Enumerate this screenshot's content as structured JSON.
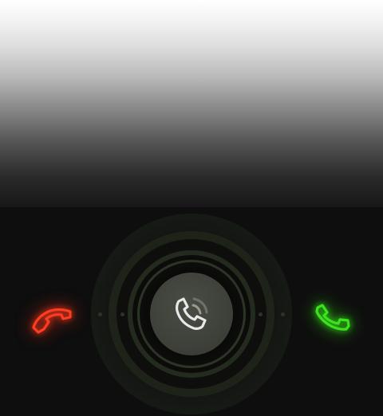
{
  "screen": {
    "type": "incoming-call"
  },
  "controls": {
    "decline": {
      "icon": "phone-hangup-icon",
      "color": "#ff3b22"
    },
    "center": {
      "icon": "phone-ringing-icon",
      "color": "#e6e6e6"
    },
    "accept": {
      "icon": "phone-answer-icon",
      "color": "#3be21d"
    }
  },
  "colors": {
    "background": "#0e0e0e",
    "top_gradient": "#ffffff",
    "dial_ring": "#1d2319",
    "center_button": "#3f423a"
  }
}
